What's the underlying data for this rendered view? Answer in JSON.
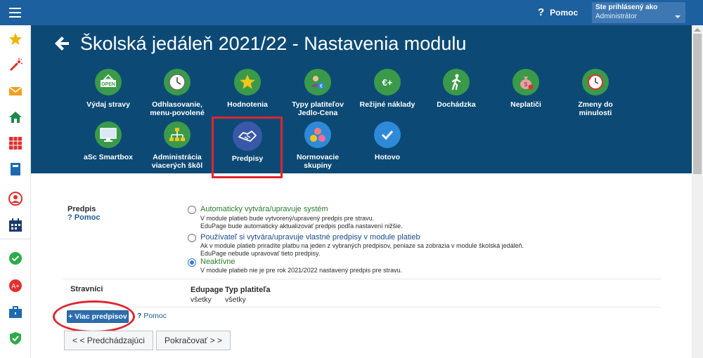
{
  "topbar": {
    "help_label": "Pomoc",
    "help_icon": "question-mark",
    "user_caption": "Ste prihlásený ako",
    "user_role": "Administrátor"
  },
  "sidebar": {
    "items": [
      {
        "icon": "star-icon",
        "color": "#f0b400"
      },
      {
        "icon": "magic-wand-icon",
        "color": "#e0302e"
      },
      {
        "icon": "mail-icon",
        "color": "#f0a020"
      },
      {
        "icon": "home-icon",
        "color": "#1e8a4a"
      },
      {
        "icon": "timetable-grid-icon",
        "color": "#e0302e"
      },
      {
        "icon": "book-icon",
        "color": "#1e6ab0"
      },
      {
        "icon": "person-icon",
        "color": "#e0302e"
      },
      {
        "icon": "calendar-icon",
        "color": "#1e3a6a"
      },
      {
        "icon": "check-circle-icon",
        "color": "#2eaa4a"
      },
      {
        "icon": "grade-circle-icon",
        "color": "#e0302e"
      },
      {
        "icon": "briefcase-icon",
        "color": "#1e6ab0"
      },
      {
        "icon": "shield-check-icon",
        "color": "#2eaa4a"
      }
    ]
  },
  "header": {
    "title": "Školská jedáleň 2021/22 - Nastavenia modulu",
    "back_icon": "arrow-left-icon"
  },
  "modules_row1": [
    {
      "label": "Výdaj stravy",
      "icon": "open-sign-icon",
      "color": "#3a9a4a"
    },
    {
      "label": "Odhlasovanie, menu-povolené",
      "icon": "clock-icon",
      "color": "#3a9a4a"
    },
    {
      "label": "Hodnotenia",
      "icon": "star-icon",
      "color": "#3a9a4a"
    },
    {
      "label": "Typy platiteľov Jedlo-Cena",
      "icon": "payer-types-icon",
      "color": "#3a9a4a"
    },
    {
      "label": "Režijné náklady",
      "icon": "euro-plus-icon",
      "color": "#3a9a4a"
    },
    {
      "label": "Dochádzka",
      "icon": "walking-person-icon",
      "color": "#3a9a4a"
    },
    {
      "label": "Neplatiči",
      "icon": "money-bag-icon",
      "color": "#3a9a4a"
    },
    {
      "label": "Zmeny do minulosti",
      "icon": "history-clock-icon",
      "color": "#3a9a4a"
    }
  ],
  "modules_row2": [
    {
      "label": "aSc Smartbox",
      "icon": "monitor-icon",
      "color": "#3a9a4a"
    },
    {
      "label": "Administrácia viacerých škôl",
      "icon": "org-chart-icon",
      "color": "#3a9a4a"
    },
    {
      "label": "Predpisy",
      "icon": "handshake-icon",
      "color": "#3a58a8"
    },
    {
      "label": "Normovacie skupiny",
      "icon": "group-dots-icon",
      "color": "#2e8ad8"
    },
    {
      "label": "Hotovo",
      "icon": "checkmark-icon",
      "color": "#2e8ad8"
    }
  ],
  "form": {
    "predpis_label": "Predpis",
    "help_label": "Pomoc",
    "options": [
      {
        "title": "Automaticky vytvára/upravuje systém",
        "desc": [
          "V module platieb bude vytvorený/upravený predpis pre stravu.",
          "EduPage bude automaticky aktualizovať predpis podľa nastavení nižšie."
        ],
        "selected": false
      },
      {
        "title": "Používateľ si vytvára/upravuje vlastné predpisy v module platieb",
        "desc": [
          "Ak v module platieb priradíte platbu na jeden z vybraných predpisov, peniaze sa zobrazia v module školská jedáleň.",
          "EduPage nebude upravovať tieto predpisy."
        ],
        "selected": false
      },
      {
        "title": "Neaktívne",
        "desc": [
          "V module platieb nie je pre rok 2021/2022 nastavený predpis pre stravu."
        ],
        "selected": true
      }
    ],
    "stravnici_label": "Stravníci",
    "col1_header": "Edupage",
    "col2_header": "Typ platiteľa",
    "col1_value": "všetky",
    "col2_value": "všetky",
    "more_button": "+ Viac predpisov",
    "help2_label": "Pomoc",
    "prev_button": "< < Predchádzajúci",
    "next_button": "Pokračovať > >"
  }
}
